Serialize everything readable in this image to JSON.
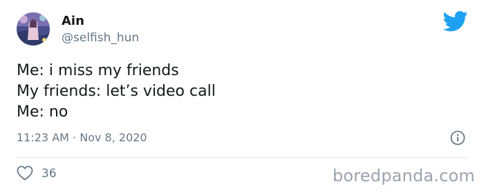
{
  "author": {
    "display_name": "Ain",
    "handle": "@selfish_hun"
  },
  "tweet": {
    "lines": [
      "Me: i miss my friends",
      "My friends: let’s video call",
      "Me: no"
    ],
    "time": "11:23 AM",
    "separator": " · ",
    "date": "Nov 8, 2020"
  },
  "engagement": {
    "likes": "36"
  },
  "watermark": "boredpanda.com",
  "icons": {
    "brand": "twitter-bird-icon",
    "info": "info-icon",
    "like": "heart-icon"
  },
  "colors": {
    "brand_blue": "#1da1f2",
    "text": "#14171a",
    "secondary": "#657786",
    "divider": "#e1e8ed"
  }
}
